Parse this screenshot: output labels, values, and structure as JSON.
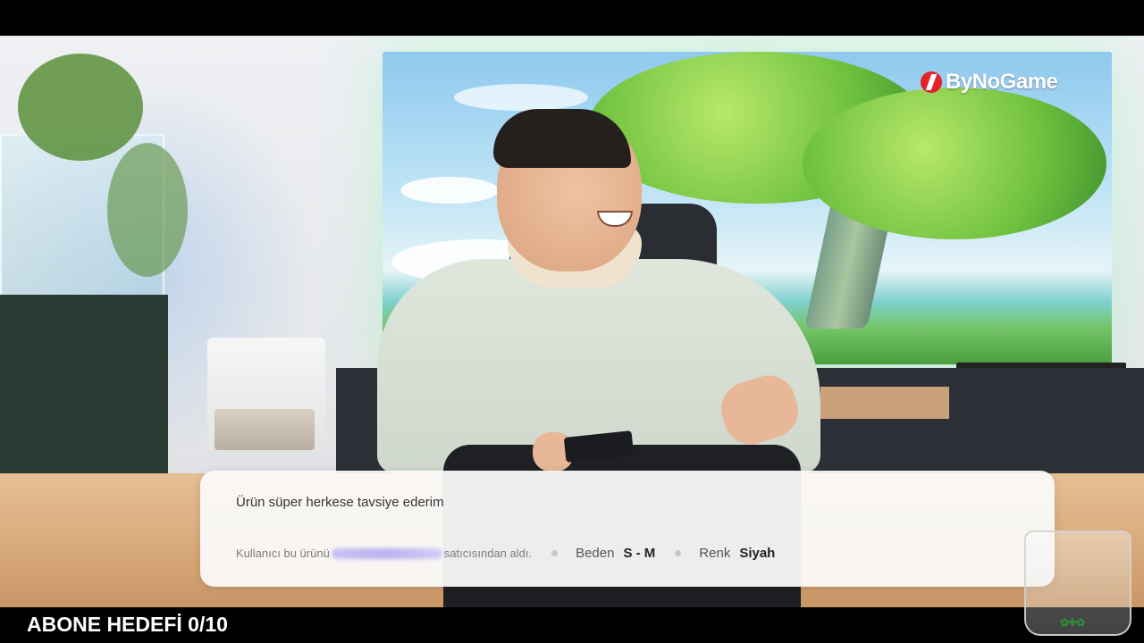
{
  "overlay": {
    "brand_logo": "ByNoGame",
    "subscriber_goal": "ABONE HEDEFİ 0/10"
  },
  "review": {
    "text": "Ürün süper herkese tavsiye ederim",
    "purchase_prefix": "Kullanıcı bu ürünü",
    "purchase_suffix": "satıcısından aldı.",
    "size_label": "Beden",
    "size_value": "S - M",
    "color_label": "Renk",
    "color_value": "Siyah"
  },
  "colors": {
    "brand_red": "#e32229",
    "card_bg": "#fafafa",
    "store_blur": "#c8c2f2"
  },
  "icons": {
    "brand": "bynogame-logo-icon",
    "glass": "glass-cup-icon"
  }
}
